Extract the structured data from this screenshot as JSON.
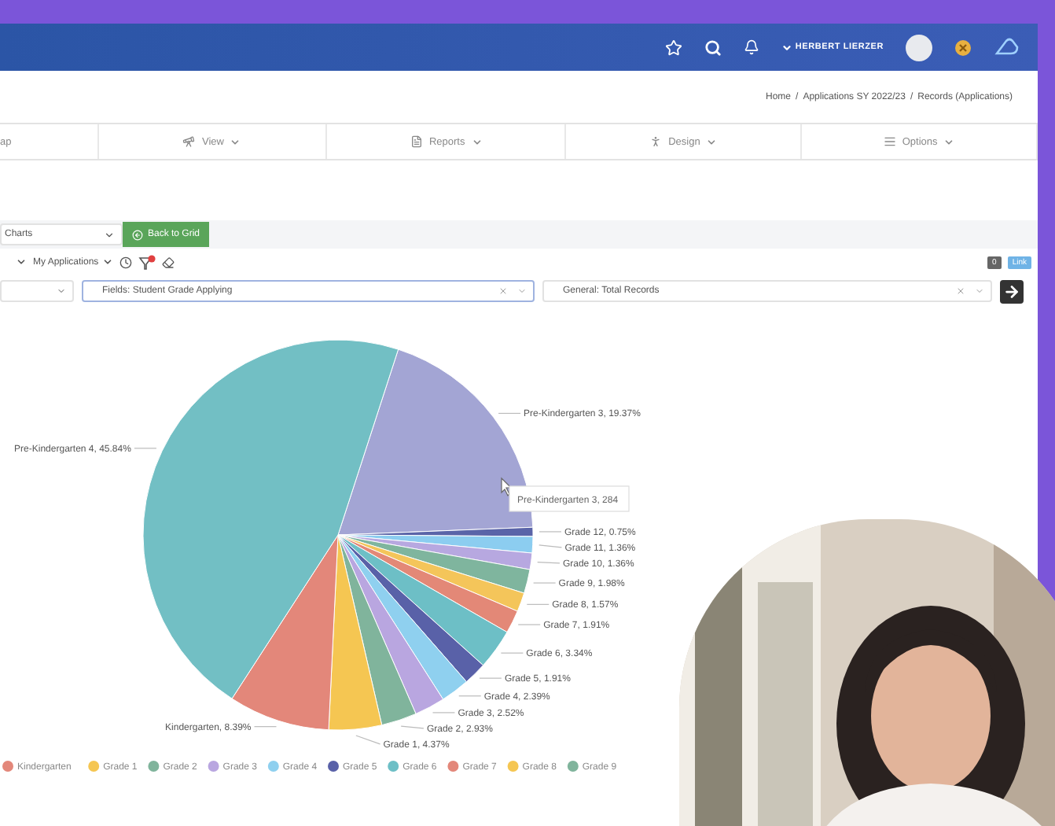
{
  "header": {
    "user": "HERBERT LIERZER"
  },
  "breadcrumb": [
    "Home",
    "/",
    "Applications SY 2022/23",
    "/",
    "Records (Applications)"
  ],
  "menu": [
    {
      "label": "ap"
    },
    {
      "label": "View"
    },
    {
      "label": "Reports"
    },
    {
      "label": "Design"
    },
    {
      "label": "Options"
    }
  ],
  "toolbar": {
    "chart_select": "Charts",
    "back_button": "Back to Grid"
  },
  "filter_row": {
    "view_select": "My Applications",
    "counter_badge": "0",
    "link_badge": "Link"
  },
  "field_selects": [
    {
      "value": "Fields: Student Grade Applying",
      "focused": true
    },
    {
      "value": "General: Total Records",
      "focused": false
    }
  ],
  "chart": {
    "chart_data": {
      "type": "pie",
      "values": [
        19.37,
        0.75,
        1.36,
        1.36,
        1.98,
        1.57,
        1.91,
        3.34,
        1.91,
        2.39,
        2.52,
        2.93,
        4.37,
        8.39,
        45.84
      ],
      "colors": [
        "#a3a5d4",
        "#5a64a8",
        "#8ccdf0",
        "#b7a8e0",
        "#7fb59e",
        "#f4c55a",
        "#e38877",
        "#6dbfc6",
        "#5961a8",
        "#8fd0ef",
        "#b9a6e0",
        "#80b49c",
        "#f5c652",
        "#e3877a",
        "#72bfc4"
      ],
      "value_labels": [
        "Pre-Kindergarten 3, 19.37%",
        "Grade 12, 0.75%",
        "Grade 11, 1.36%",
        "Grade 10, 1.36%",
        "Grade 9, 1.98%",
        "Grade 8, 1.57%",
        "Grade 7, 1.91%",
        "Grade 6, 3.34%",
        "Grade 5, 1.91%",
        "Grade 4, 2.39%",
        "Grade 3, 2.52%",
        "Grade 2, 2.93%",
        "Grade 1, 4.37%",
        "Kindergarten, 8.39%",
        "Pre-Kindergarten 4, 45.84%"
      ],
      "annotations": [
        "Pre-Kindergarten 3, 284"
      ]
    },
    "legend": [
      {
        "label": "Kindergarten",
        "color": "#e3877a"
      },
      {
        "label": "Grade 1",
        "color": "#f5c652"
      },
      {
        "label": "Grade 2",
        "color": "#80b49c"
      },
      {
        "label": "Grade 3",
        "color": "#b9a6e0"
      },
      {
        "label": "Grade 4",
        "color": "#8fd0ef"
      },
      {
        "label": "Grade 5",
        "color": "#5961a8"
      },
      {
        "label": "Grade 6",
        "color": "#6dbfc6"
      },
      {
        "label": "Grade 7",
        "color": "#e3877a"
      },
      {
        "label": "Grade 8",
        "color": "#f5c652"
      },
      {
        "label": "Grade 9",
        "color": "#80b49c"
      }
    ]
  }
}
